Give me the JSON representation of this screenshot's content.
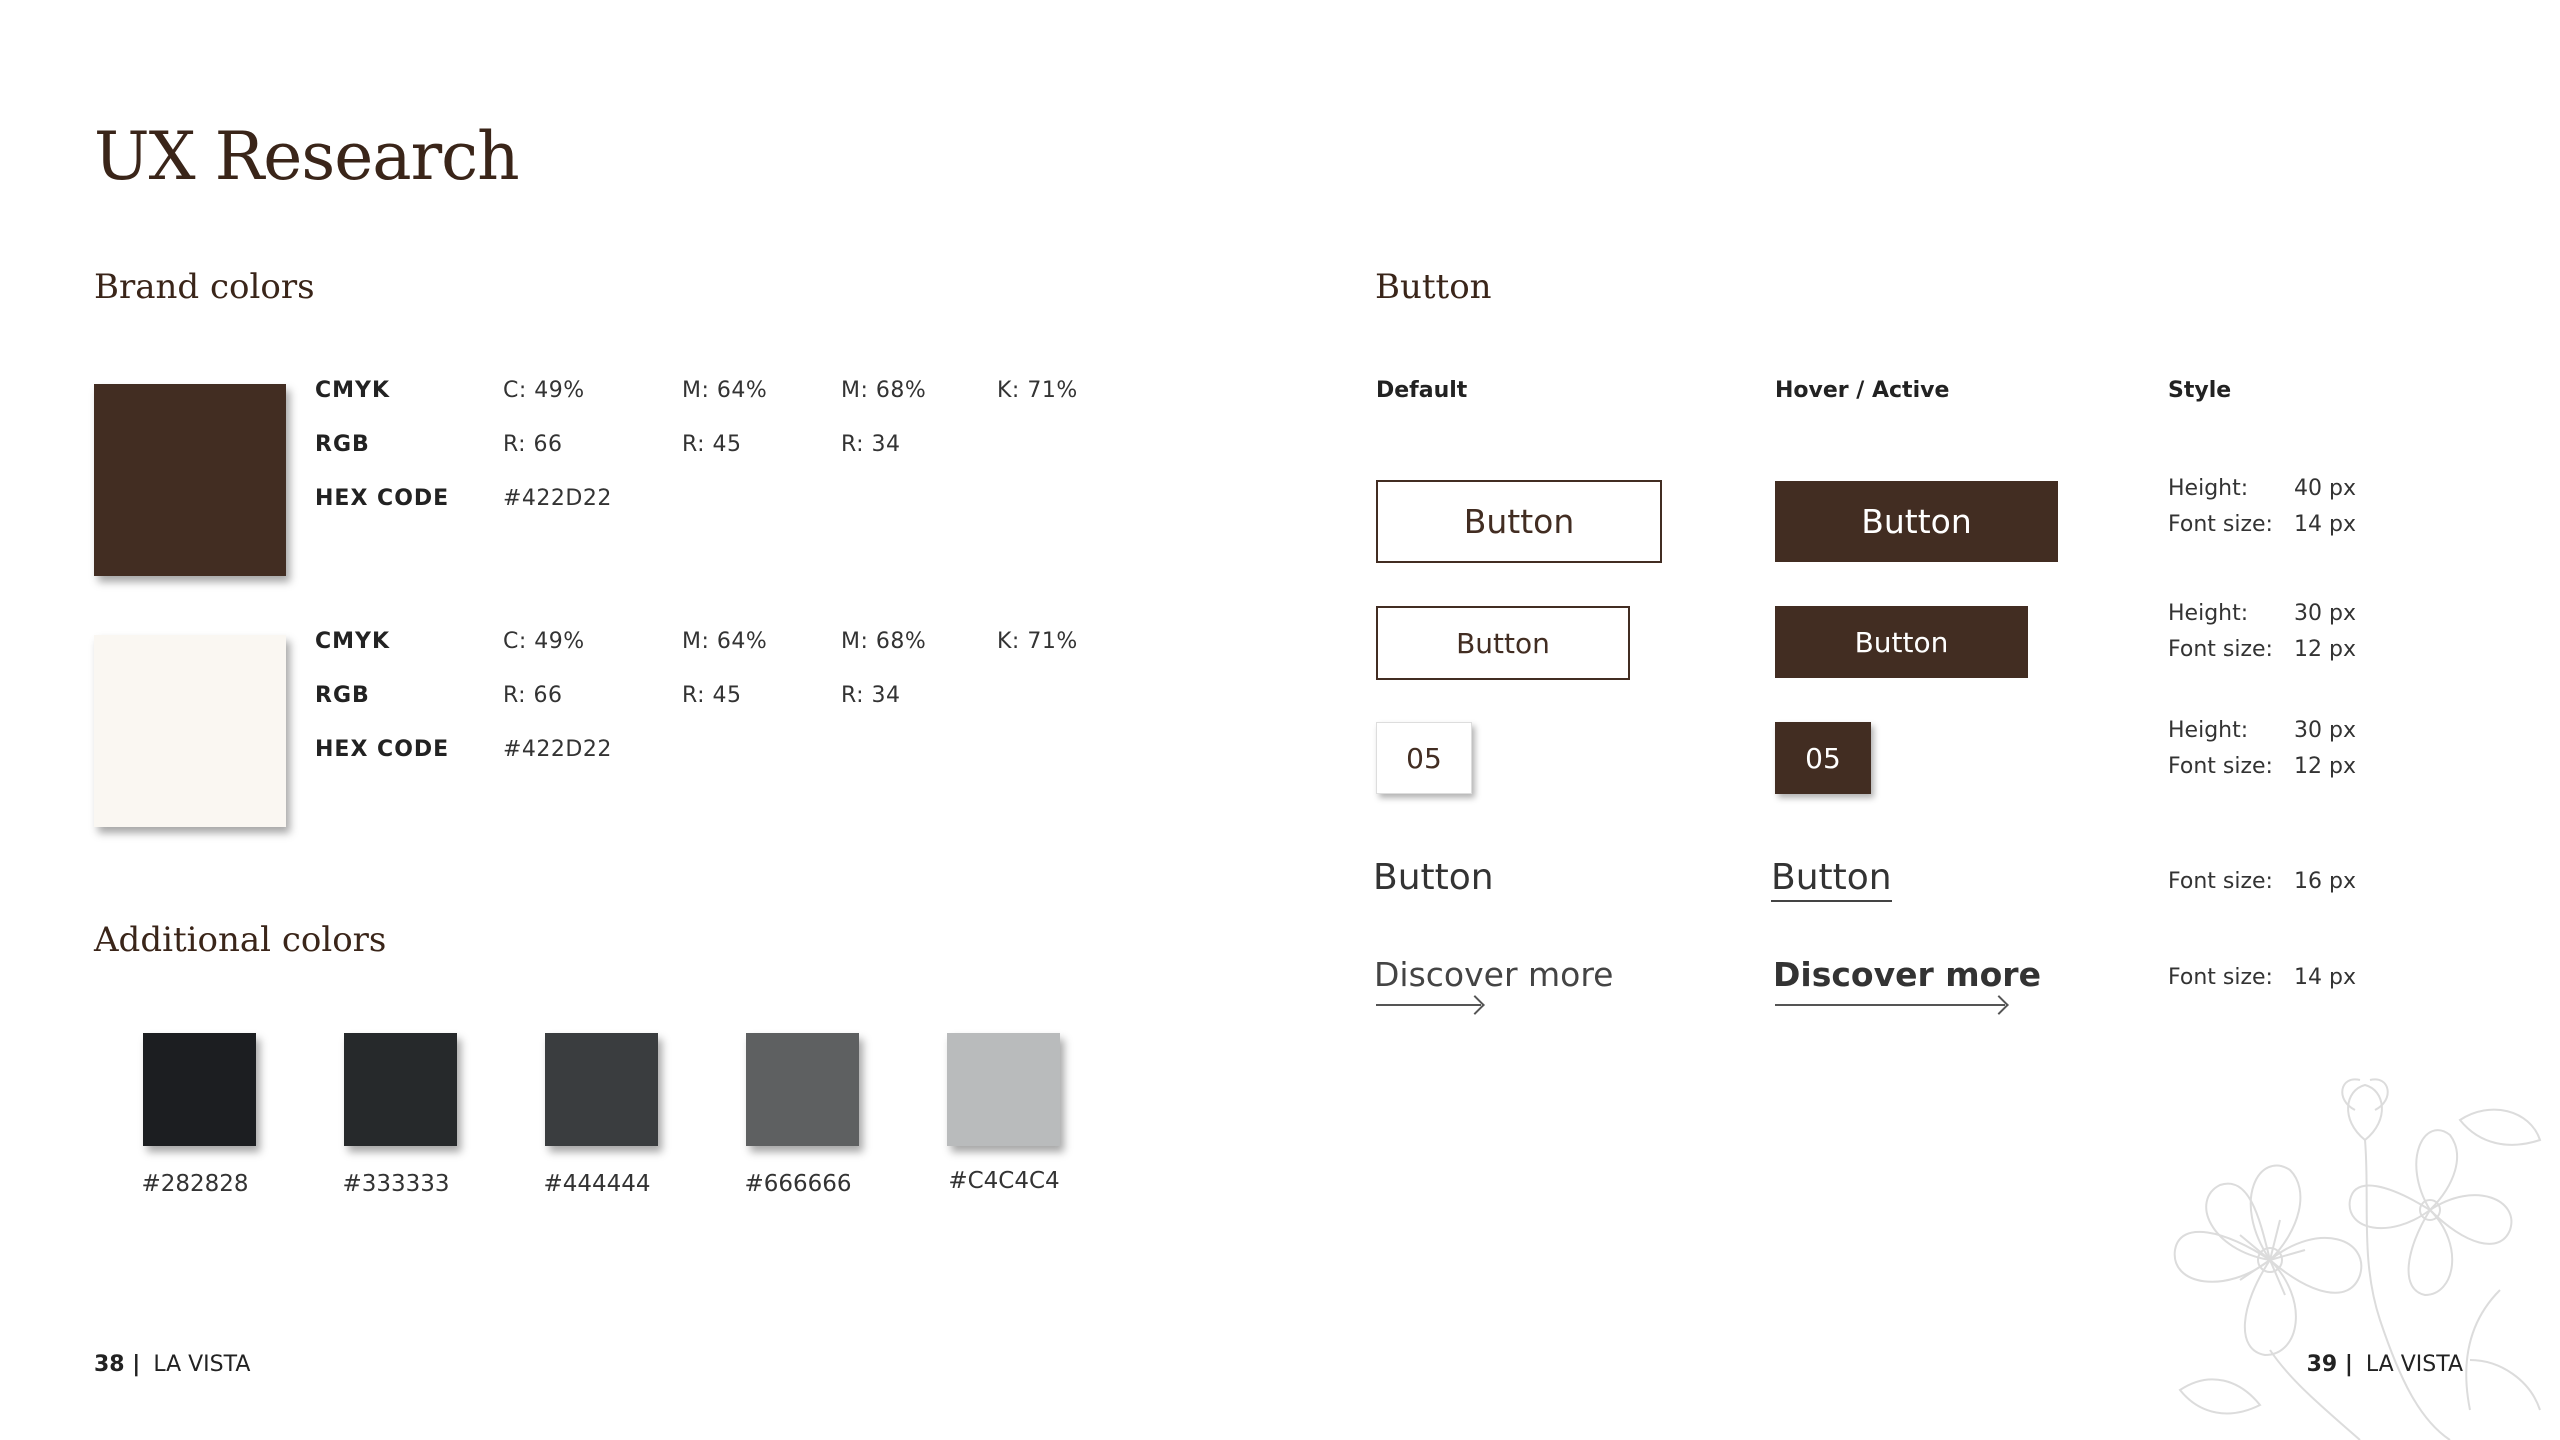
{
  "page": {
    "title": "UX Research"
  },
  "brand": {
    "title": "Brand colors",
    "colors": [
      {
        "swatch": "#422D22",
        "cmyk_label": "CMYK",
        "c": "C: 49%",
        "m1": "M: 64%",
        "m2": "M: 68%",
        "k": "K: 71%",
        "rgb_label": "RGB",
        "r1": "R: 66",
        "r2": "R: 45",
        "r3": "R: 34",
        "hex_label": "HEX CODE",
        "hex": "#422D22"
      },
      {
        "swatch": "#FAF7F2",
        "cmyk_label": "CMYK",
        "c": "C: 49%",
        "m1": "M: 64%",
        "m2": "M: 68%",
        "k": "K: 71%",
        "rgb_label": "RGB",
        "r1": "R: 66",
        "r2": "R: 45",
        "r3": "R: 34",
        "hex_label": "HEX CODE",
        "hex": "#422D22"
      }
    ]
  },
  "additional": {
    "title": "Additional colors",
    "colors": [
      {
        "swatch": "#1C1E21",
        "hex": "#282828"
      },
      {
        "swatch": "#26292B",
        "hex": "#333333"
      },
      {
        "swatch": "#3A3D3F",
        "hex": "#444444"
      },
      {
        "swatch": "#5E6061",
        "hex": "#666666"
      },
      {
        "swatch": "#B9BBBC",
        "hex": "#C4C4C4"
      }
    ]
  },
  "button_section": {
    "title": "Button",
    "col_default": "Default",
    "col_hover": "Hover / Active",
    "col_style": "Style",
    "btn_large": "Button",
    "btn_medium": "Button",
    "btn_number": "05",
    "text_btn": "Button",
    "link_label": "Discover more",
    "styles": {
      "row1": {
        "height_key": "Height:",
        "height_val": "40 px",
        "font_key": "Font size:",
        "font_val": "14 px"
      },
      "row2": {
        "height_key": "Height:",
        "height_val": "30 px",
        "font_key": "Font size:",
        "font_val": "12 px"
      },
      "row3": {
        "height_key": "Height:",
        "height_val": "30 px",
        "font_key": "Font size:",
        "font_val": "12 px"
      },
      "row4": {
        "font_key": "Font size:",
        "font_val": "16 px"
      },
      "row5": {
        "font_key": "Font size:",
        "font_val": "14 px"
      }
    }
  },
  "footer": {
    "left_num": "38 |",
    "left_name": "LA VISTA",
    "right_num": "39 |",
    "right_name": "LA VISTA"
  },
  "colors": {
    "brand_dark": "#422D22",
    "brand_light": "#FAF7F2"
  }
}
